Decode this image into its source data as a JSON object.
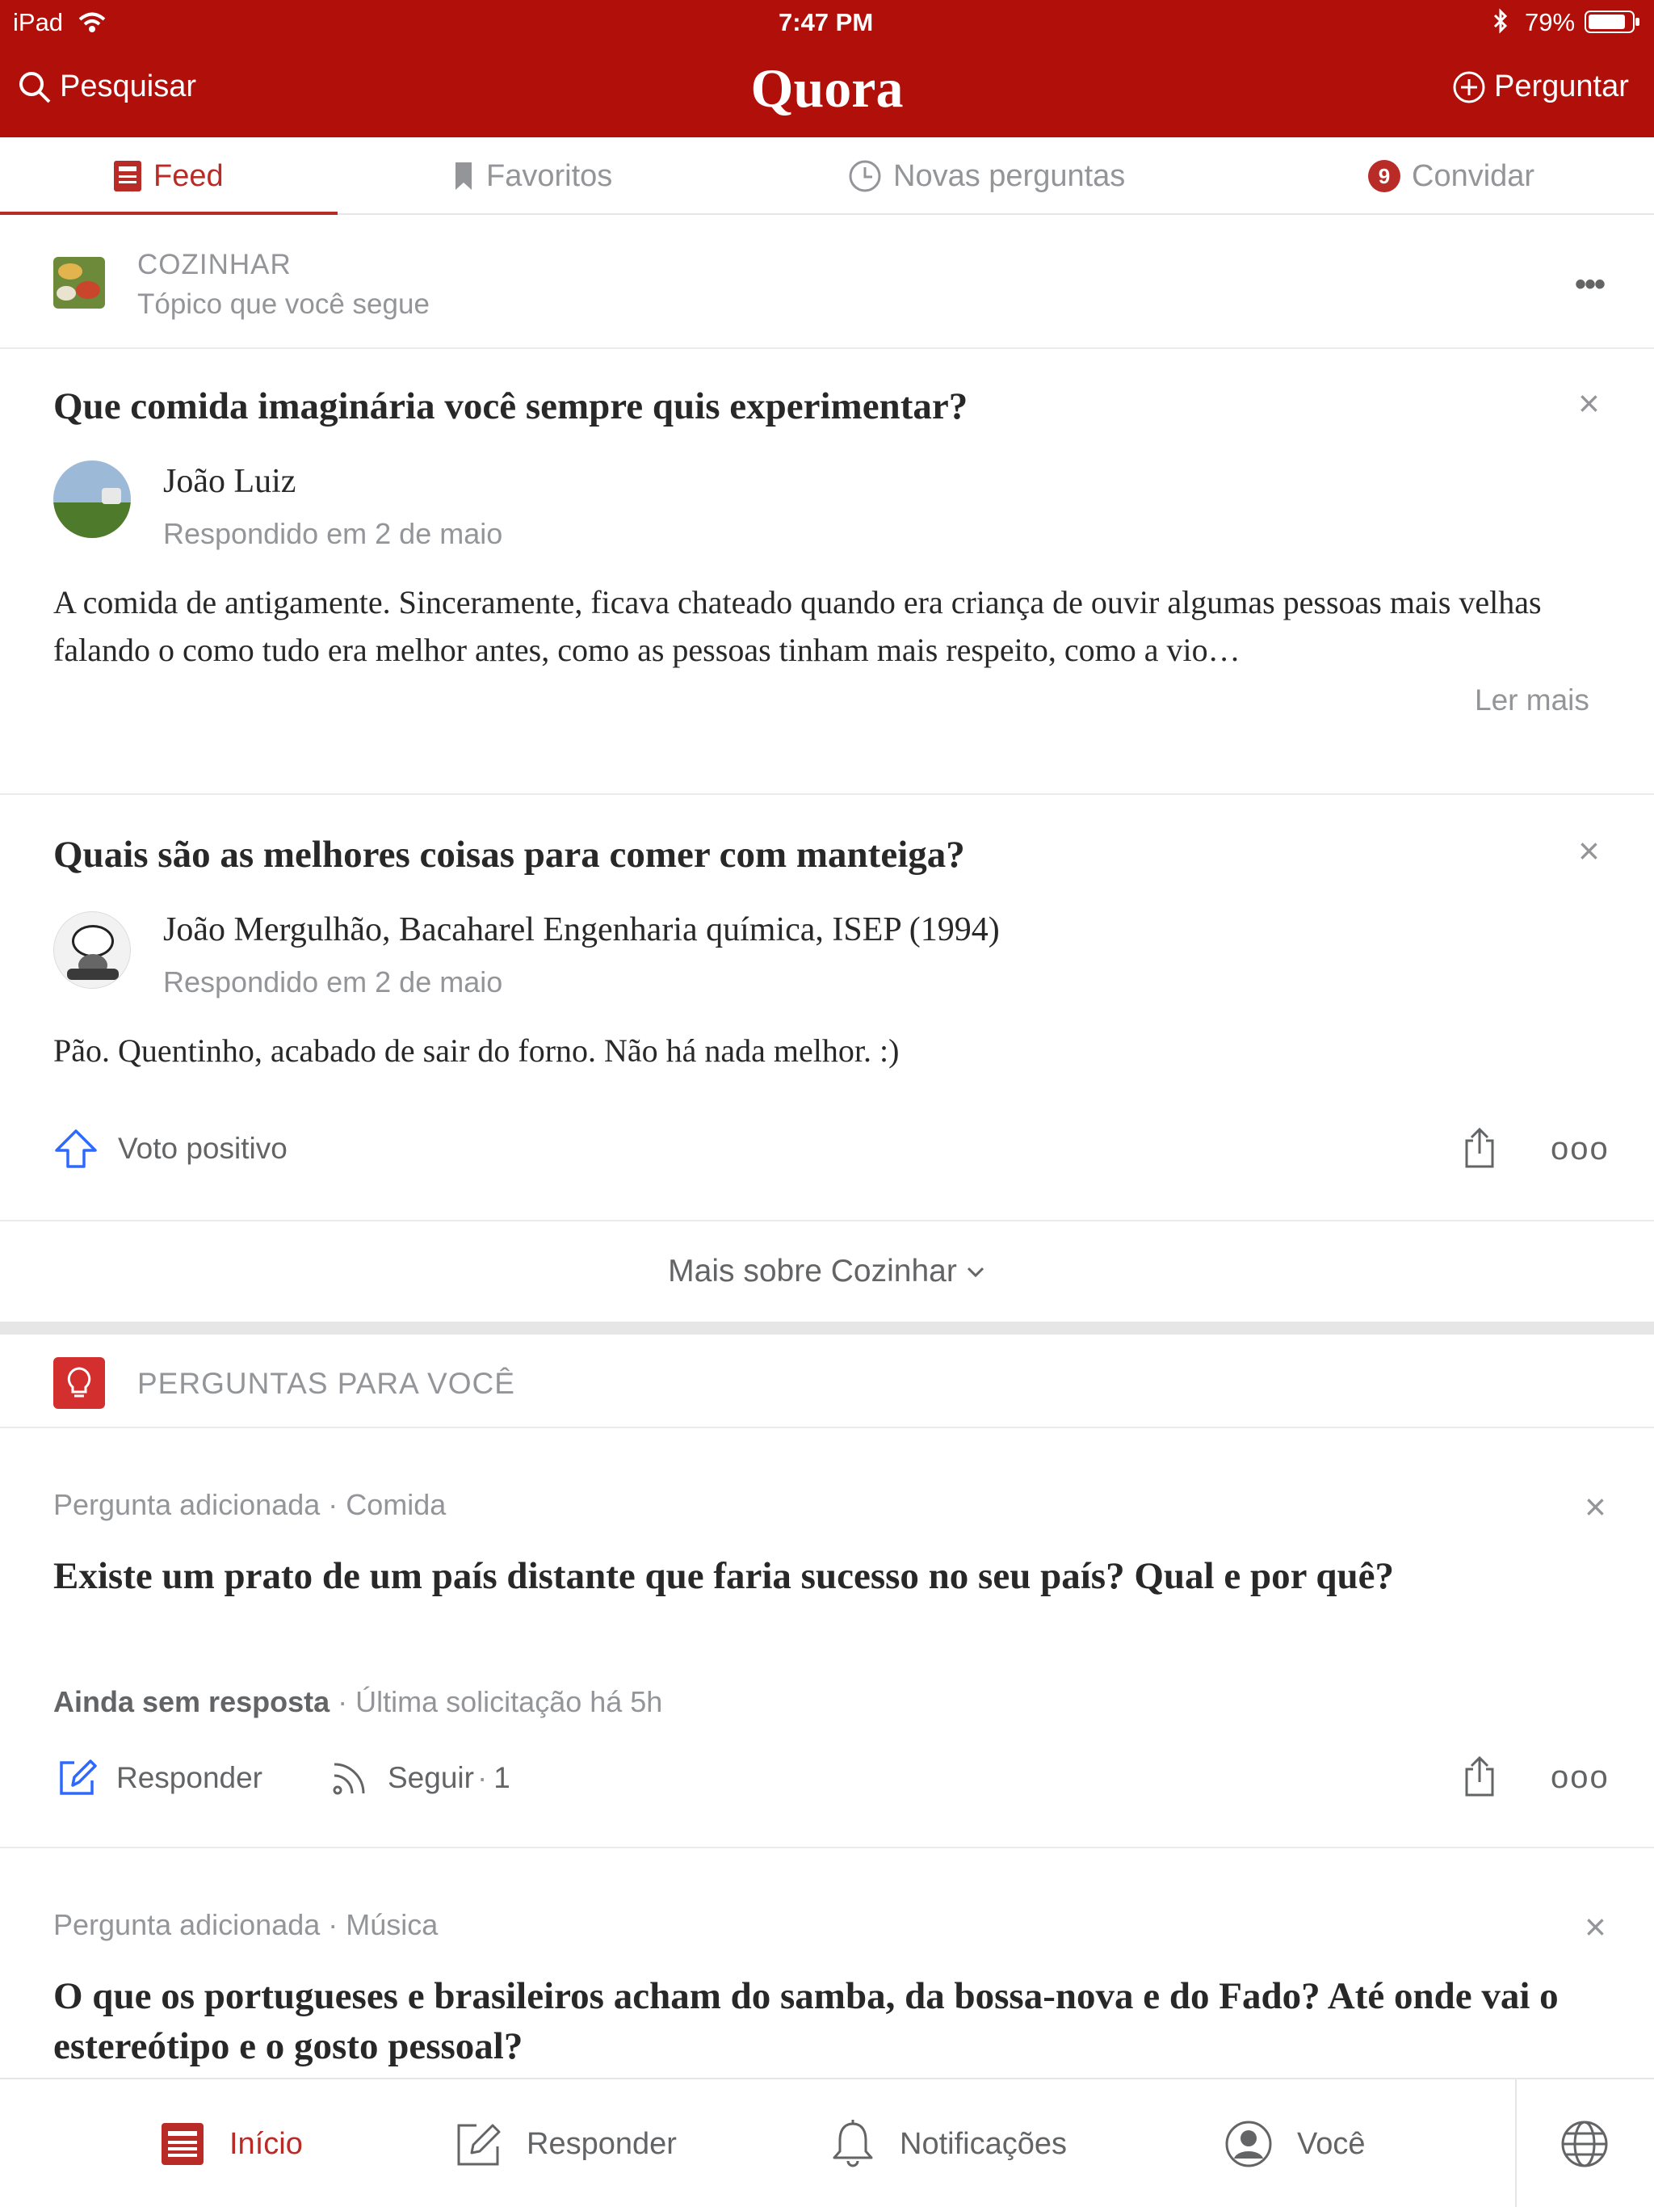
{
  "status_bar": {
    "device": "iPad",
    "time": "7:47 PM",
    "battery": "79%"
  },
  "header": {
    "search_label": "Pesquisar",
    "logo": "Quora",
    "ask_label": "Perguntar",
    "brand_color": "#b00f0a"
  },
  "tabs": [
    {
      "label": "Feed",
      "icon": "feed-icon",
      "active": true
    },
    {
      "label": "Favoritos",
      "icon": "bookmark-icon"
    },
    {
      "label": "Novas perguntas",
      "icon": "clock-icon"
    },
    {
      "label": "Convidar",
      "icon": "invite-badge",
      "badge": "9"
    }
  ],
  "topic": {
    "name": "COZINHAR",
    "subtitle": "Tópico que você segue"
  },
  "answers": [
    {
      "question": "Que comida imaginária você sempre quis experimentar?",
      "author": "João Luiz",
      "answered": "Respondido em 2 de maio",
      "text": "A comida de antigamente. Sinceramente, ficava chateado quando era criança de ouvir algumas pessoas mais velhas falando o como tudo era melhor antes, como as pessoas tinham mais respeito, como a vio…",
      "read_more": "Ler mais"
    },
    {
      "question": "Quais são as melhores coisas para comer com manteiga?",
      "author": "João Mergulhão, Bacaharel Engenharia química, ISEP (1994)",
      "answered": "Respondido em 2 de maio",
      "text": "Pão. Quentinho, acabado de sair do forno. Não há nada melhor. :)",
      "upvote_label": "Voto positivo"
    }
  ],
  "more_topic": "Mais sobre Cozinhar",
  "questions_section": {
    "title": "PERGUNTAS PARA VOCÊ"
  },
  "questions": [
    {
      "meta_prefix": "Pergunta adicionada",
      "meta_topic": "Comida",
      "question": "Existe um prato de um país distante que faria sucesso no seu país? Qual e por quê?",
      "status": "Ainda sem resposta",
      "last_request": "Última solicitação há 5h",
      "answer_label": "Responder",
      "follow_label": "Seguir",
      "follow_count": "1"
    },
    {
      "meta_prefix": "Pergunta adicionada",
      "meta_topic": "Música",
      "question": "O que os portugueses e brasileiros acham do samba, da bossa-nova e do Fado? Até onde vai o estereótipo e o gosto pessoal?"
    }
  ],
  "bottom_nav": [
    {
      "label": "Início",
      "icon": "home-icon",
      "active": true
    },
    {
      "label": "Responder",
      "icon": "pencil-icon"
    },
    {
      "label": "Notificações",
      "icon": "bell-icon"
    },
    {
      "label": "Você",
      "icon": "profile-icon"
    },
    {
      "label": "",
      "icon": "globe-icon"
    }
  ],
  "colors": {
    "accent": "#b92b27",
    "muted": "#939598",
    "link_blue": "#2e69ff"
  }
}
